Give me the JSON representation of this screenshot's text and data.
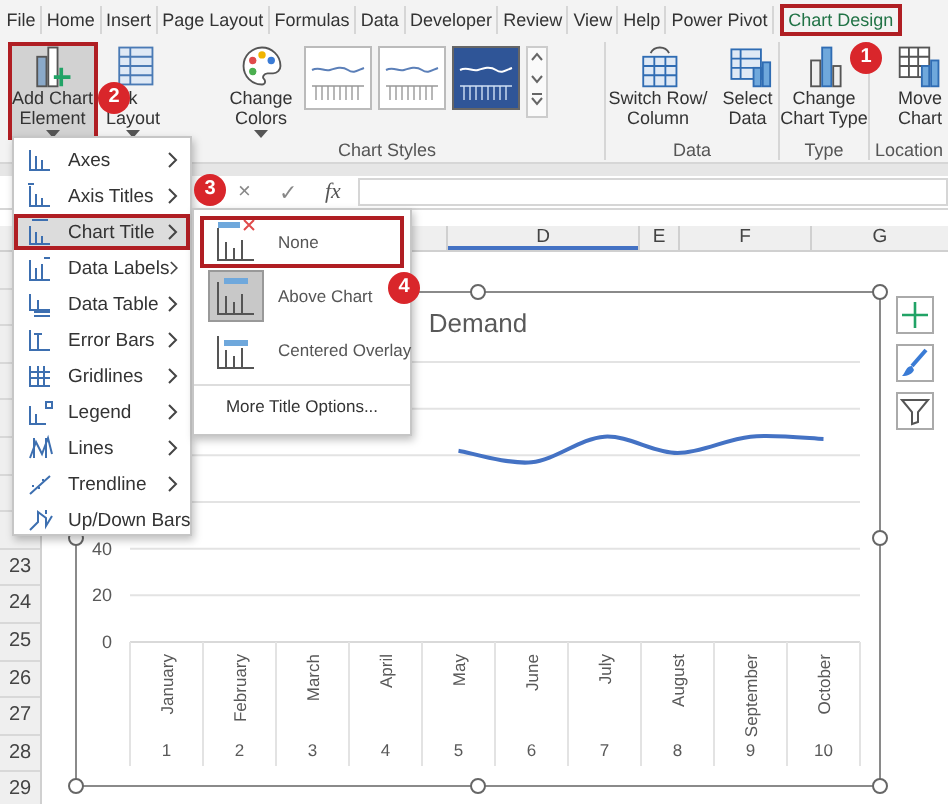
{
  "ribbon_tabs": [
    {
      "label": "File",
      "selected": false,
      "outlined": false
    },
    {
      "label": "Home",
      "selected": false,
      "outlined": false
    },
    {
      "label": "Insert",
      "selected": false,
      "outlined": false
    },
    {
      "label": "Page Layout",
      "selected": false,
      "outlined": false
    },
    {
      "label": "Formulas",
      "selected": false,
      "outlined": false
    },
    {
      "label": "Data",
      "selected": false,
      "outlined": false
    },
    {
      "label": "Developer",
      "selected": false,
      "outlined": false
    },
    {
      "label": "Review",
      "selected": false,
      "outlined": false
    },
    {
      "label": "View",
      "selected": false,
      "outlined": false
    },
    {
      "label": "Help",
      "selected": false,
      "outlined": false
    },
    {
      "label": "Power Pivot",
      "selected": false,
      "outlined": false
    },
    {
      "label": "Chart Design",
      "selected": true,
      "outlined": true,
      "badge": "1"
    }
  ],
  "ribbon": {
    "groups": [
      {
        "buttons": [
          {
            "lines": [
              "Add Chart",
              "Element"
            ],
            "dropdown": true,
            "pressed": true,
            "outlined": true,
            "badge": "2"
          },
          {
            "lines": [
              "k",
              "Layout"
            ],
            "dropdown": true,
            "pressed": false,
            "outlined": false
          }
        ]
      },
      {
        "label": "Chart Styles",
        "buttons": [
          {
            "lines": [
              "Change",
              "Colors"
            ],
            "dropdown": true,
            "pressed": false,
            "outlined": false
          }
        ],
        "gallery": [
          {
            "selected": false
          },
          {
            "selected": false
          },
          {
            "selected": true
          }
        ]
      },
      {
        "label": "Data",
        "buttons": [
          {
            "lines": [
              "Switch Row/",
              "Column"
            ],
            "dropdown": false,
            "pressed": false,
            "outlined": false
          },
          {
            "lines": [
              "Select",
              "Data"
            ],
            "dropdown": false,
            "pressed": false,
            "outlined": false
          }
        ]
      },
      {
        "label": "Type",
        "buttons": [
          {
            "lines": [
              "Change",
              "Chart Type"
            ],
            "dropdown": false,
            "pressed": false,
            "outlined": false
          }
        ]
      },
      {
        "label": "Location",
        "buttons": [
          {
            "lines": [
              "Move",
              "Chart"
            ],
            "dropdown": false,
            "pressed": false,
            "outlined": false
          }
        ]
      }
    ]
  },
  "formula_bar": {
    "cancel": "×",
    "enter": "✓",
    "function": "fx"
  },
  "sheet": {
    "columns": [
      {
        "label": "D",
        "highlighted": true
      },
      {
        "label": "E",
        "highlighted": false
      },
      {
        "label": "F",
        "highlighted": false
      },
      {
        "label": "G",
        "highlighted": false
      }
    ],
    "rows": [
      "23",
      "24",
      "25",
      "26",
      "27",
      "28",
      "29"
    ]
  },
  "chart": {
    "chart_data": {
      "type": "line",
      "title": "Demand",
      "categories": [
        "January",
        "February",
        "March",
        "April",
        "May",
        "June",
        "July",
        "August",
        "September",
        "October"
      ],
      "series": [
        {
          "color": "#4472c4",
          "values": [
            null,
            null,
            null,
            null,
            82,
            77,
            88,
            81,
            88,
            87
          ]
        }
      ],
      "ylim": [
        0,
        120
      ],
      "yticks": [
        0,
        20,
        40
      ]
    },
    "category_numbers": [
      "1",
      "2",
      "3",
      "4",
      "5",
      "6",
      "7",
      "8",
      "9",
      "10"
    ]
  },
  "element_menu": {
    "items": [
      {
        "label": "Axes",
        "highlighted": false,
        "outlined": false
      },
      {
        "label": "Axis Titles",
        "highlighted": false,
        "outlined": false
      },
      {
        "label": "Chart Title",
        "highlighted": true,
        "outlined": true,
        "badge": "3"
      },
      {
        "label": "Data Labels",
        "highlighted": false,
        "outlined": false
      },
      {
        "label": "Data Table",
        "highlighted": false,
        "outlined": false
      },
      {
        "label": "Error Bars",
        "highlighted": false,
        "outlined": false
      },
      {
        "label": "Gridlines",
        "highlighted": false,
        "outlined": false
      },
      {
        "label": "Legend",
        "highlighted": false,
        "outlined": false
      },
      {
        "label": "Lines",
        "highlighted": false,
        "outlined": false
      },
      {
        "label": "Trendline",
        "highlighted": false,
        "outlined": false
      },
      {
        "label": "Up/Down Bars",
        "highlighted": false,
        "outlined": false
      }
    ]
  },
  "title_submenu": {
    "options": [
      {
        "label": "None",
        "selected": false,
        "outlined": true,
        "badge": "4"
      },
      {
        "label": "Above Chart",
        "selected": true,
        "outlined": false
      },
      {
        "label": "Centered Overlay",
        "selected": false,
        "outlined": false
      }
    ],
    "more_options": "More Title Options..."
  }
}
